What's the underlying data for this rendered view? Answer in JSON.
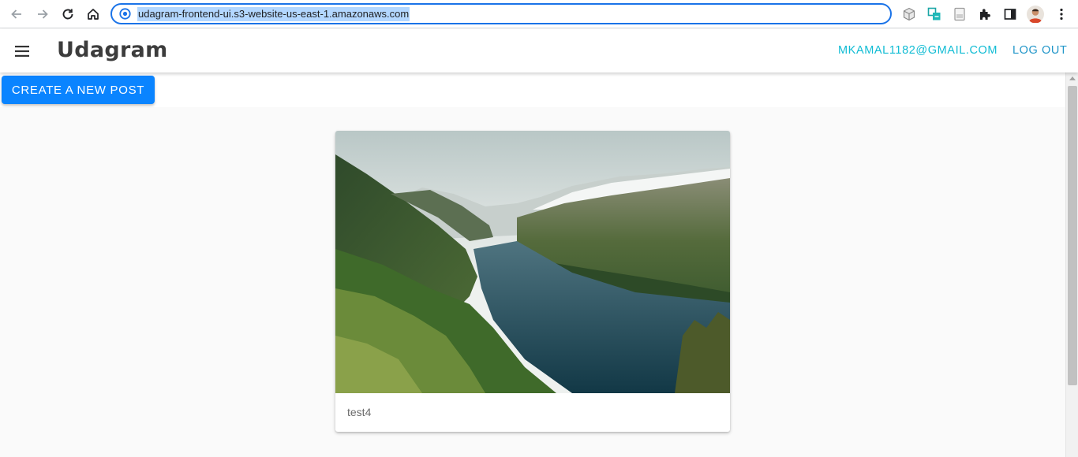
{
  "browser": {
    "url": "udagram-frontend-ui.s3-website-us-east-1.amazonaws.com"
  },
  "app": {
    "brand": "Udagram",
    "user_email": "MKAMAL1182@GMAIL.COM",
    "logout_label": "LOG OUT",
    "create_post_label": "CREATE A NEW POST"
  },
  "feed": {
    "posts": [
      {
        "caption": "test4",
        "image": "fjord-landscape-photo"
      }
    ]
  },
  "colors": {
    "accent_button": "#0a84ff",
    "user_link": "#10bcd4",
    "logout_link": "#2196c9",
    "omnibox_focus": "#1a73e8"
  }
}
